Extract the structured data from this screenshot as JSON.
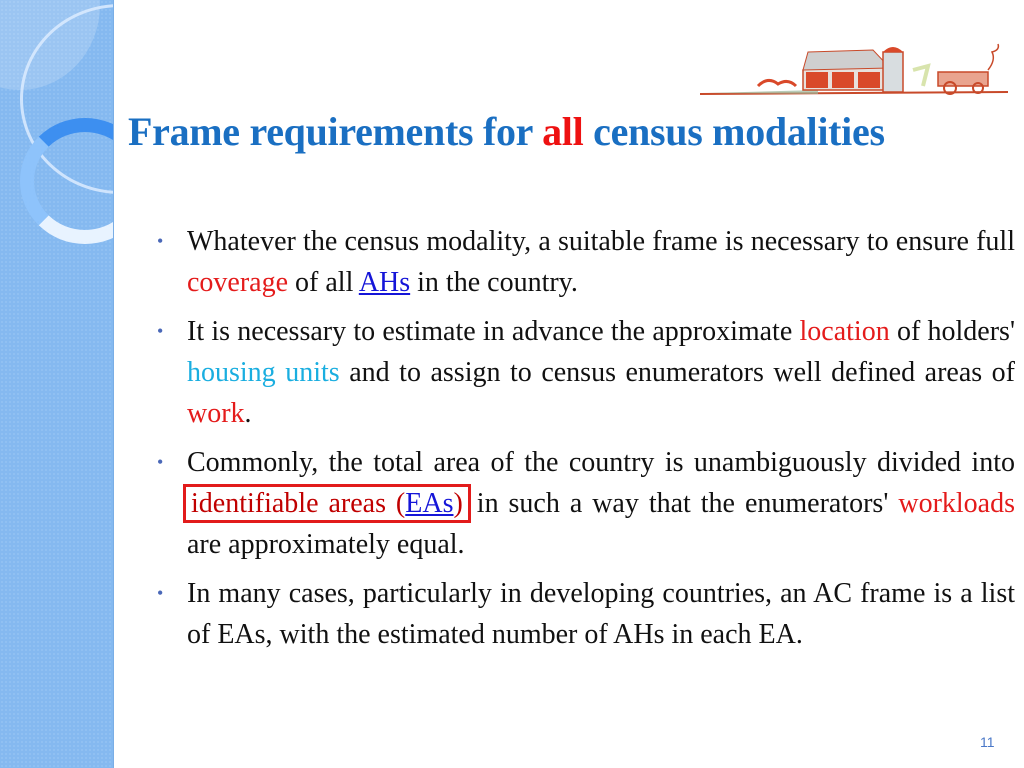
{
  "slide": {
    "title_parts": [
      "Frame requirements for ",
      "all",
      " census  modalities"
    ],
    "decoration": "farm-barn-illustration",
    "bullets": [
      {
        "parts": [
          {
            "text": "Whatever the census modality, a suitable frame is necessary to ensure full ",
            "style": "normal"
          },
          {
            "text": "coverage",
            "style": "red"
          },
          {
            "text": " of all ",
            "style": "normal"
          },
          {
            "text": "AHs",
            "style": "link"
          },
          {
            "text": " in the country.",
            "style": "normal"
          }
        ]
      },
      {
        "parts": [
          {
            "text": "It is necessary to estimate in advance the approximate ",
            "style": "normal"
          },
          {
            "text": "location",
            "style": "red"
          },
          {
            "text": " of holders' ",
            "style": "normal"
          },
          {
            "text": "housing units",
            "style": "cyan"
          },
          {
            "text": " and to assign to census enumerators well defined areas of ",
            "style": "normal"
          },
          {
            "text": "work",
            "style": "red"
          },
          {
            "text": ".",
            "style": "normal"
          }
        ]
      },
      {
        "parts": [
          {
            "text": "Commonly, the total area of the country is unambiguously divided into ",
            "style": "normal"
          },
          {
            "text": "identifiable areas (",
            "style": "boxed-darkred"
          },
          {
            "text": "EAs",
            "style": "boxed-link"
          },
          {
            "text": ")",
            "style": "boxed-darkred"
          },
          {
            "text": " in such a way that the enumerators' ",
            "style": "normal"
          },
          {
            "text": "workloads",
            "style": "red"
          },
          {
            "text": " are approximately equal.",
            "style": "normal"
          }
        ]
      },
      {
        "parts": [
          {
            "text": "In many cases, particularly in developing countries, an AC frame is a list of EAs, with the estimated number of AHs in each EA.",
            "style": "normal"
          }
        ]
      }
    ],
    "page_number": "11",
    "colors": {
      "title": "#1a6fc2",
      "title_highlight": "#ee1111",
      "emphasis_red": "#e41b1b",
      "emphasis_cyan": "#1aaee0",
      "link": "#1515d8",
      "box": "#e21b1b",
      "sidebar": "#85b9f0"
    }
  }
}
